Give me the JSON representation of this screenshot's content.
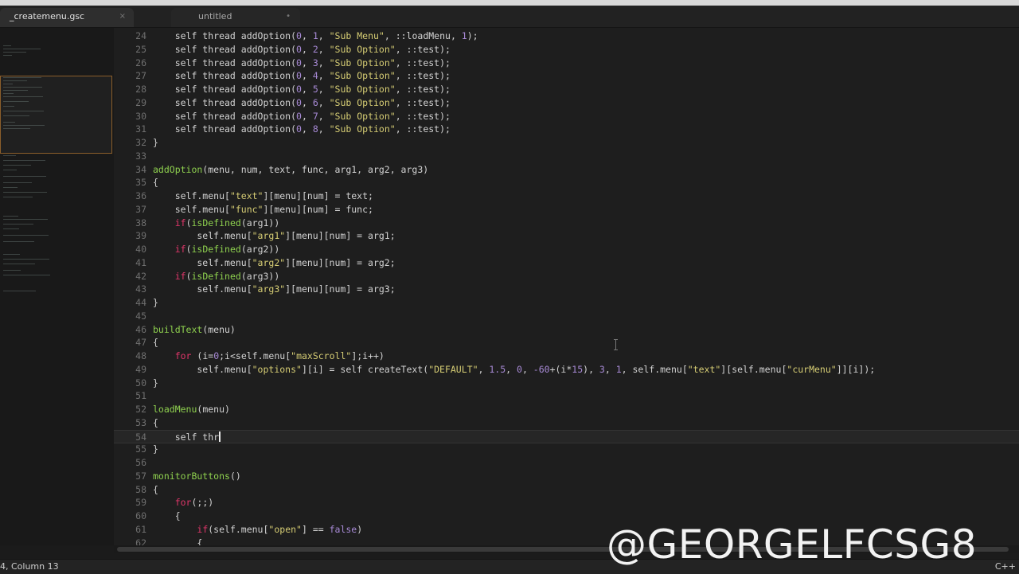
{
  "tabs": [
    {
      "label": "_createmenu.gsc",
      "close": "×"
    },
    {
      "label": "untitled",
      "modified": "•"
    }
  ],
  "editor": {
    "lines": [
      {
        "n": "24",
        "t": [
          [
            "    self thread addOption(",
            ""
          ],
          [
            "0",
            "num"
          ],
          [
            ", ",
            ""
          ],
          [
            "1",
            "num"
          ],
          [
            ", ",
            ""
          ],
          [
            "\"Sub Menu\"",
            "str"
          ],
          [
            ", ::loadMenu, ",
            ""
          ],
          [
            "1",
            "num"
          ],
          [
            ");",
            ""
          ]
        ]
      },
      {
        "n": "25",
        "t": [
          [
            "    self thread addOption(",
            ""
          ],
          [
            "0",
            "num"
          ],
          [
            ", ",
            ""
          ],
          [
            "2",
            "num"
          ],
          [
            ", ",
            ""
          ],
          [
            "\"Sub Option\"",
            "str"
          ],
          [
            ", ::test);",
            ""
          ]
        ]
      },
      {
        "n": "26",
        "t": [
          [
            "    self thread addOption(",
            ""
          ],
          [
            "0",
            "num"
          ],
          [
            ", ",
            ""
          ],
          [
            "3",
            "num"
          ],
          [
            ", ",
            ""
          ],
          [
            "\"Sub Option\"",
            "str"
          ],
          [
            ", ::test);",
            ""
          ]
        ]
      },
      {
        "n": "27",
        "t": [
          [
            "    self thread addOption(",
            ""
          ],
          [
            "0",
            "num"
          ],
          [
            ", ",
            ""
          ],
          [
            "4",
            "num"
          ],
          [
            ", ",
            ""
          ],
          [
            "\"Sub Option\"",
            "str"
          ],
          [
            ", ::test);",
            ""
          ]
        ]
      },
      {
        "n": "28",
        "t": [
          [
            "    self thread addOption(",
            ""
          ],
          [
            "0",
            "num"
          ],
          [
            ", ",
            ""
          ],
          [
            "5",
            "num"
          ],
          [
            ", ",
            ""
          ],
          [
            "\"Sub Option\"",
            "str"
          ],
          [
            ", ::test);",
            ""
          ]
        ]
      },
      {
        "n": "29",
        "t": [
          [
            "    self thread addOption(",
            ""
          ],
          [
            "0",
            "num"
          ],
          [
            ", ",
            ""
          ],
          [
            "6",
            "num"
          ],
          [
            ", ",
            ""
          ],
          [
            "\"Sub Option\"",
            "str"
          ],
          [
            ", ::test);",
            ""
          ]
        ]
      },
      {
        "n": "30",
        "t": [
          [
            "    self thread addOption(",
            ""
          ],
          [
            "0",
            "num"
          ],
          [
            ", ",
            ""
          ],
          [
            "7",
            "num"
          ],
          [
            ", ",
            ""
          ],
          [
            "\"Sub Option\"",
            "str"
          ],
          [
            ", ::test);",
            ""
          ]
        ]
      },
      {
        "n": "31",
        "t": [
          [
            "    self thread addOption(",
            ""
          ],
          [
            "0",
            "num"
          ],
          [
            ", ",
            ""
          ],
          [
            "8",
            "num"
          ],
          [
            ", ",
            ""
          ],
          [
            "\"Sub Option\"",
            "str"
          ],
          [
            ", ::test);",
            ""
          ]
        ]
      },
      {
        "n": "32",
        "t": [
          [
            "}",
            ""
          ]
        ]
      },
      {
        "n": "33",
        "t": []
      },
      {
        "n": "34",
        "t": [
          [
            "addOption",
            "fn"
          ],
          [
            "(menu, num, text, func, arg1, arg2, arg3)",
            ""
          ]
        ]
      },
      {
        "n": "35",
        "t": [
          [
            "{",
            ""
          ]
        ]
      },
      {
        "n": "36",
        "t": [
          [
            "    self.menu[",
            ""
          ],
          [
            "\"text\"",
            "str"
          ],
          [
            "][menu][num] = text;",
            ""
          ]
        ]
      },
      {
        "n": "37",
        "t": [
          [
            "    self.menu[",
            ""
          ],
          [
            "\"func\"",
            "str"
          ],
          [
            "][menu][num] = func;",
            ""
          ]
        ]
      },
      {
        "n": "38",
        "t": [
          [
            "    ",
            ""
          ],
          [
            "if",
            "kw"
          ],
          [
            "(",
            ""
          ],
          [
            "isDefined",
            "fn"
          ],
          [
            "(arg1))",
            ""
          ]
        ]
      },
      {
        "n": "39",
        "t": [
          [
            "        self.menu[",
            ""
          ],
          [
            "\"arg1\"",
            "str"
          ],
          [
            "][menu][num] = arg1;",
            ""
          ]
        ]
      },
      {
        "n": "40",
        "t": [
          [
            "    ",
            ""
          ],
          [
            "if",
            "kw"
          ],
          [
            "(",
            ""
          ],
          [
            "isDefined",
            "fn"
          ],
          [
            "(arg2))",
            ""
          ]
        ]
      },
      {
        "n": "41",
        "t": [
          [
            "        self.menu[",
            ""
          ],
          [
            "\"arg2\"",
            "str"
          ],
          [
            "][menu][num] = arg2;",
            ""
          ]
        ]
      },
      {
        "n": "42",
        "t": [
          [
            "    ",
            ""
          ],
          [
            "if",
            "kw"
          ],
          [
            "(",
            ""
          ],
          [
            "isDefined",
            "fn"
          ],
          [
            "(arg3))",
            ""
          ]
        ]
      },
      {
        "n": "43",
        "t": [
          [
            "        self.menu[",
            ""
          ],
          [
            "\"arg3\"",
            "str"
          ],
          [
            "][menu][num] = arg3;",
            ""
          ]
        ]
      },
      {
        "n": "44",
        "t": [
          [
            "}",
            ""
          ]
        ]
      },
      {
        "n": "45",
        "t": []
      },
      {
        "n": "46",
        "t": [
          [
            "buildText",
            "fn"
          ],
          [
            "(menu)",
            ""
          ]
        ]
      },
      {
        "n": "47",
        "t": [
          [
            "{",
            ""
          ]
        ]
      },
      {
        "n": "48",
        "t": [
          [
            "    ",
            ""
          ],
          [
            "for",
            "kw"
          ],
          [
            " (i=",
            ""
          ],
          [
            "0",
            "num"
          ],
          [
            ";i<self.menu[",
            ""
          ],
          [
            "\"maxScroll\"",
            "str"
          ],
          [
            "];i++)",
            ""
          ]
        ]
      },
      {
        "n": "49",
        "t": [
          [
            "        self.menu[",
            ""
          ],
          [
            "\"options\"",
            "str"
          ],
          [
            "][i] = self createText(",
            ""
          ],
          [
            "\"DEFAULT\"",
            "str"
          ],
          [
            ", ",
            ""
          ],
          [
            "1.5",
            "num"
          ],
          [
            ", ",
            ""
          ],
          [
            "0",
            "num"
          ],
          [
            ", ",
            ""
          ],
          [
            "-60",
            "num"
          ],
          [
            "+(i*",
            ""
          ],
          [
            "15",
            "num"
          ],
          [
            "), ",
            ""
          ],
          [
            "3",
            "num"
          ],
          [
            ", ",
            ""
          ],
          [
            "1",
            "num"
          ],
          [
            ", self.menu[",
            ""
          ],
          [
            "\"text\"",
            "str"
          ],
          [
            "][self.menu[",
            ""
          ],
          [
            "\"curMenu\"",
            "str"
          ],
          [
            "]][i]);",
            ""
          ]
        ]
      },
      {
        "n": "50",
        "t": [
          [
            "}",
            ""
          ]
        ]
      },
      {
        "n": "51",
        "t": []
      },
      {
        "n": "52",
        "t": [
          [
            "loadMenu",
            "fn"
          ],
          [
            "(menu)",
            ""
          ]
        ]
      },
      {
        "n": "53",
        "t": [
          [
            "{",
            ""
          ]
        ]
      },
      {
        "n": "54",
        "t": [
          [
            "    self thr",
            ""
          ]
        ],
        "current": true
      },
      {
        "n": "55",
        "t": [
          [
            "}",
            ""
          ]
        ]
      },
      {
        "n": "56",
        "t": []
      },
      {
        "n": "57",
        "t": [
          [
            "monitorButtons",
            "fn"
          ],
          [
            "()",
            ""
          ]
        ]
      },
      {
        "n": "58",
        "t": [
          [
            "{",
            ""
          ]
        ]
      },
      {
        "n": "59",
        "t": [
          [
            "    ",
            ""
          ],
          [
            "for",
            "kw"
          ],
          [
            "(;;)",
            ""
          ]
        ]
      },
      {
        "n": "60",
        "t": [
          [
            "    {",
            ""
          ]
        ]
      },
      {
        "n": "61",
        "t": [
          [
            "        ",
            ""
          ],
          [
            "if",
            "kw"
          ],
          [
            "(self.menu[",
            ""
          ],
          [
            "\"open\"",
            "str"
          ],
          [
            "] == ",
            ""
          ],
          [
            "false",
            "num"
          ],
          [
            ")",
            ""
          ]
        ]
      },
      {
        "n": "62",
        "t": [
          [
            "        {",
            ""
          ]
        ]
      }
    ]
  },
  "status": {
    "position": "4, Column 13",
    "syntax": "C++"
  },
  "watermark": "@GEORGELFCSG8",
  "colors": {
    "string": "#d6cd74",
    "number": "#a88ad6",
    "function": "#8fd14f",
    "keyword": "#e0366a",
    "plain": "#d2d2d2"
  }
}
